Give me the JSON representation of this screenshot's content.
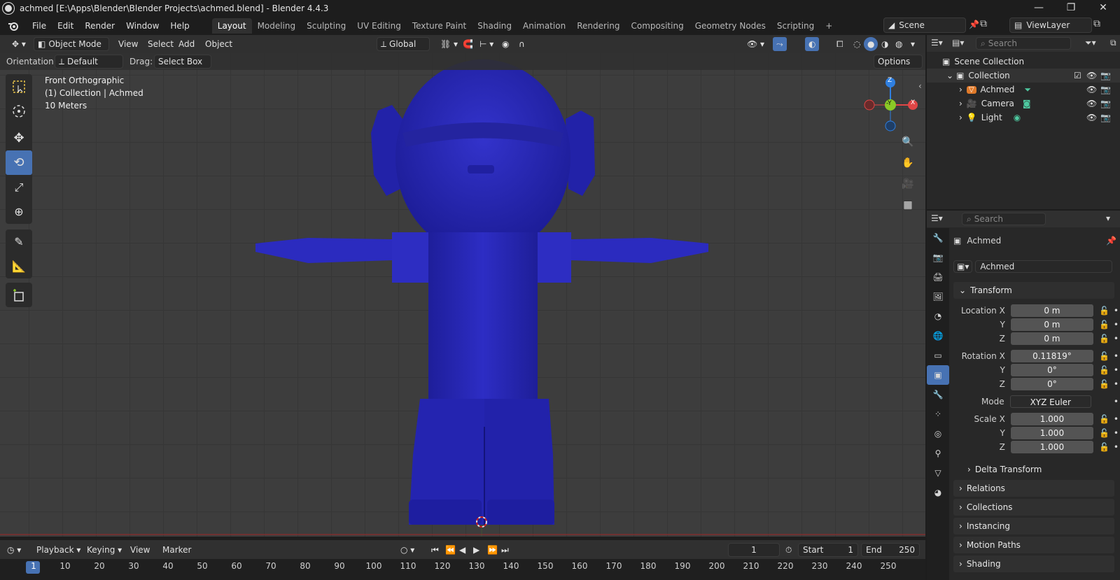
{
  "window": {
    "title": "achmed [E:\\Apps\\Blender\\Blender Projects\\achmed.blend] - Blender 4.4.3",
    "min": "—",
    "max": "❐",
    "close": "✕"
  },
  "menus": [
    "File",
    "Edit",
    "Render",
    "Window",
    "Help"
  ],
  "workspaces": [
    "Layout",
    "Modeling",
    "Sculpting",
    "UV Editing",
    "Texture Paint",
    "Shading",
    "Animation",
    "Rendering",
    "Compositing",
    "Geometry Nodes",
    "Scripting"
  ],
  "active_workspace": "Layout",
  "add_tab": "+",
  "scene": {
    "name": "Scene",
    "viewlayer": "ViewLayer"
  },
  "viewport": {
    "mode": "Object Mode",
    "menus": [
      "View",
      "Select",
      "Add",
      "Object"
    ],
    "transform_orientation": "Global",
    "orientation_label": "Orientation:",
    "orientation_value": "Default",
    "drag_label": "Drag:",
    "drag_value": "Select Box",
    "options": "Options",
    "overlay_lines": [
      "Front Orthographic",
      "(1) Collection | Achmed",
      "10 Meters"
    ],
    "gizmo": {
      "z": "Z",
      "x": "X",
      "y": "-Y"
    },
    "search_placeholder": "Search"
  },
  "outliner": {
    "search_placeholder": "Search",
    "scene_collection": "Scene Collection",
    "collection": "Collection",
    "items": [
      "Achmed",
      "Camera",
      "Light"
    ]
  },
  "properties": {
    "search_placeholder": "Search",
    "object_name": "Achmed",
    "object_field": "Achmed",
    "transform_title": "Transform",
    "rows": [
      {
        "label": "Location X",
        "value": "0 m"
      },
      {
        "label": "Y",
        "value": "0 m"
      },
      {
        "label": "Z",
        "value": "0 m"
      },
      {
        "label": "Rotation X",
        "value": "0.11819°"
      },
      {
        "label": "Y",
        "value": "0°"
      },
      {
        "label": "Z",
        "value": "0°"
      },
      {
        "label": "Mode",
        "value": "XYZ Euler"
      },
      {
        "label": "Scale X",
        "value": "1.000"
      },
      {
        "label": "Y",
        "value": "1.000"
      },
      {
        "label": "Z",
        "value": "1.000"
      }
    ],
    "delta_transform": "Delta Transform",
    "sections": [
      "Relations",
      "Collections",
      "Instancing",
      "Motion Paths",
      "Shading"
    ]
  },
  "timeline": {
    "menus": [
      "Playback",
      "Keying",
      "View",
      "Marker"
    ],
    "current_frame": "1",
    "start_label": "Start",
    "start_value": "1",
    "end_label": "End",
    "end_value": "250",
    "ticks": [
      "1",
      "10",
      "20",
      "30",
      "40",
      "50",
      "60",
      "70",
      "80",
      "90",
      "100",
      "110",
      "120",
      "130",
      "140",
      "150",
      "160",
      "170",
      "180",
      "190",
      "200",
      "210",
      "220",
      "230",
      "240",
      "250"
    ]
  },
  "colors": {
    "accent": "#4772b3",
    "model": "#2a2ab8",
    "gizmo_x": "#e04646",
    "gizmo_y": "#8ac926",
    "gizmo_z": "#2f7fe0"
  }
}
